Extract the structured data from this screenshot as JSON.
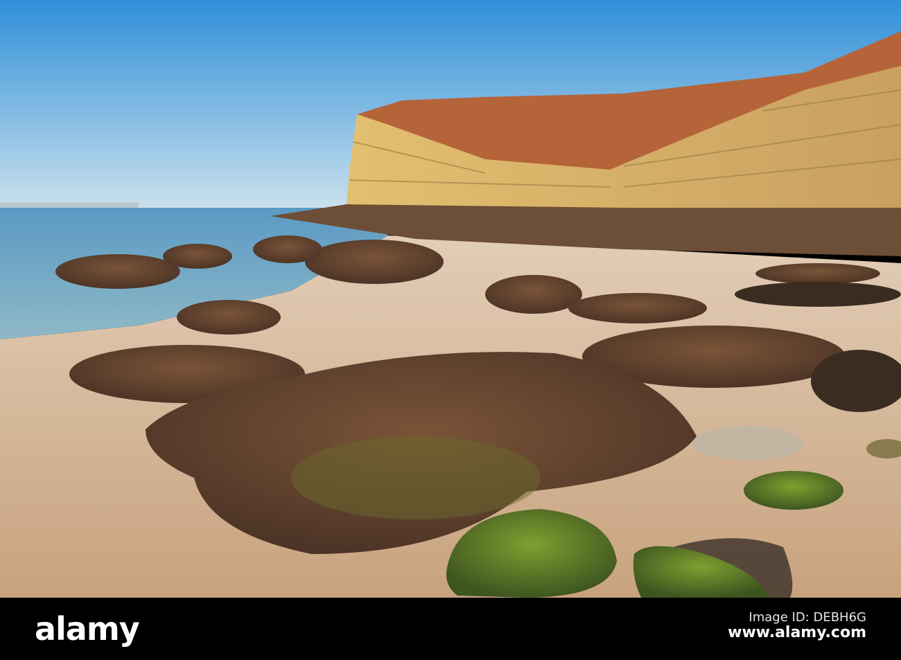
{
  "photo": {
    "subject": "rocky beach with sandstone cliff"
  },
  "watermark": {
    "logo": "alamy",
    "image_id": "Image ID: DEBH6G",
    "url": "www.alamy.com"
  },
  "colors": {
    "sky_top": "#2f8fd8",
    "sky_bottom": "#cfe3ee",
    "sea": "#4f8fb8",
    "sand": "#d9bfa0",
    "cliff": "#d9b06a",
    "heather": "#b5643a",
    "rock": "#6a4a36",
    "moss": "#6f8a2a"
  }
}
